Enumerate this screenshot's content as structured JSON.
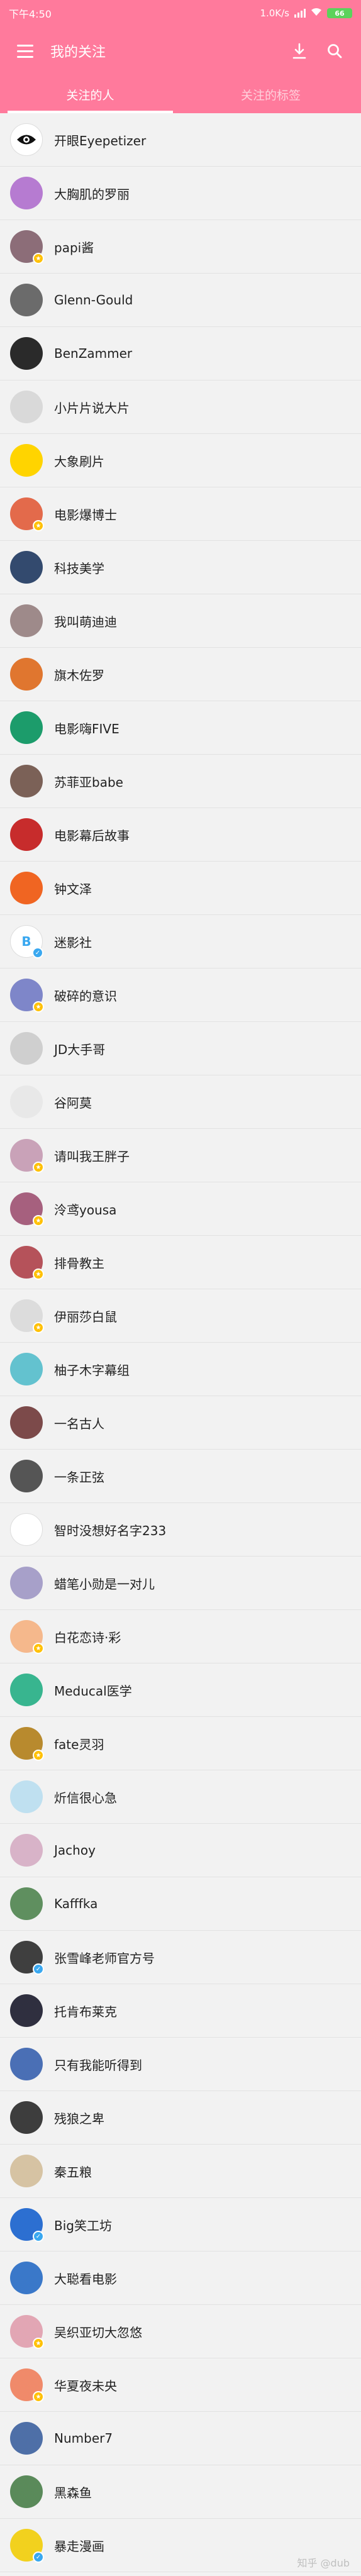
{
  "status": {
    "time": "下午4:50",
    "speed": "1.0K/s",
    "battery": "66"
  },
  "toolbar": {
    "title": "我的关注",
    "menu_icon": "menu-icon",
    "download_icon": "download-icon",
    "search_icon": "search-icon"
  },
  "tabs": [
    {
      "label": "关注的人",
      "active": true
    },
    {
      "label": "关注的标签",
      "active": false
    }
  ],
  "users": [
    {
      "name": "开眼Eyepetizer",
      "color": "#ffffff",
      "avatar": "eye",
      "badge": ""
    },
    {
      "name": "大胸肌的罗丽",
      "color": "#b67bd1",
      "avatar": "",
      "badge": ""
    },
    {
      "name": "papi酱",
      "color": "#8c6d78",
      "avatar": "",
      "badge": "gold"
    },
    {
      "name": "Glenn-Gould",
      "color": "#6b6b6b",
      "avatar": "",
      "badge": ""
    },
    {
      "name": "BenZammer",
      "color": "#2a2a2a",
      "avatar": "",
      "badge": ""
    },
    {
      "name": "小片片说大片",
      "color": "#d9d9d9",
      "avatar": "",
      "badge": ""
    },
    {
      "name": "大象刷片",
      "color": "#ffd400",
      "avatar": "",
      "badge": ""
    },
    {
      "name": "电影爆博士",
      "color": "#e36a4b",
      "avatar": "",
      "badge": "gold"
    },
    {
      "name": "科技美学",
      "color": "#334a6e",
      "avatar": "",
      "badge": ""
    },
    {
      "name": "我叫萌迪迪",
      "color": "#9e8a8a",
      "avatar": "",
      "badge": ""
    },
    {
      "name": "旗木佐罗",
      "color": "#e0762f",
      "avatar": "",
      "badge": ""
    },
    {
      "name": "电影嗨FIVE",
      "color": "#1c9c6b",
      "avatar": "",
      "badge": ""
    },
    {
      "name": "苏菲亚babe",
      "color": "#7b6157",
      "avatar": "",
      "badge": ""
    },
    {
      "name": "电影幕后故事",
      "color": "#c72c2c",
      "avatar": "",
      "badge": ""
    },
    {
      "name": "钟文泽",
      "color": "#f06522",
      "avatar": "",
      "badge": ""
    },
    {
      "name": "迷影社",
      "color": "#ffffff",
      "avatar": "B",
      "badge": "blue"
    },
    {
      "name": "破碎的意识",
      "color": "#7e86c9",
      "avatar": "",
      "badge": "gold"
    },
    {
      "name": "JD大手哥",
      "color": "#cfcfcf",
      "avatar": "",
      "badge": ""
    },
    {
      "name": "谷阿莫",
      "color": "#e8e8e8",
      "avatar": "",
      "badge": ""
    },
    {
      "name": "请叫我王胖子",
      "color": "#c9a2b8",
      "avatar": "",
      "badge": "gold"
    },
    {
      "name": "泠鸢yousa",
      "color": "#a6607e",
      "avatar": "",
      "badge": "gold"
    },
    {
      "name": "排骨教主",
      "color": "#b5525a",
      "avatar": "",
      "badge": "gold"
    },
    {
      "name": "伊丽莎白鼠",
      "color": "#dcdcdc",
      "avatar": "",
      "badge": "gold"
    },
    {
      "name": "柚子木字幕组",
      "color": "#63c2cf",
      "avatar": "",
      "badge": ""
    },
    {
      "name": "一名古人",
      "color": "#7c4a4a",
      "avatar": "",
      "badge": ""
    },
    {
      "name": "一条正弦",
      "color": "#555555",
      "avatar": "",
      "badge": ""
    },
    {
      "name": "智时没想好名字233",
      "color": "#ffffff",
      "avatar": "",
      "badge": ""
    },
    {
      "name": "蜡笔小勋是一对儿",
      "color": "#a7a0c9",
      "avatar": "",
      "badge": ""
    },
    {
      "name": "白花恋诗·彩",
      "color": "#f5b88c",
      "avatar": "",
      "badge": "gold"
    },
    {
      "name": "Meducal医学",
      "color": "#38b58f",
      "avatar": "",
      "badge": ""
    },
    {
      "name": "fate灵羽",
      "color": "#b88a2e",
      "avatar": "",
      "badge": "gold"
    },
    {
      "name": "炘信很心急",
      "color": "#bfe0f0",
      "avatar": "",
      "badge": ""
    },
    {
      "name": "Jachoy",
      "color": "#d8b3c8",
      "avatar": "",
      "badge": ""
    },
    {
      "name": "Kafffka",
      "color": "#5f8f5f",
      "avatar": "",
      "badge": ""
    },
    {
      "name": "张雪峰老师官方号",
      "color": "#3f3f3f",
      "avatar": "",
      "badge": "blue"
    },
    {
      "name": "托肯布莱克",
      "color": "#2f2f3f",
      "avatar": "",
      "badge": ""
    },
    {
      "name": "只有我能听得到",
      "color": "#4a6fb5",
      "avatar": "",
      "badge": ""
    },
    {
      "name": "残狼之卑",
      "color": "#3d3d3d",
      "avatar": "",
      "badge": ""
    },
    {
      "name": "秦五粮",
      "color": "#d6c3a3",
      "avatar": "",
      "badge": ""
    },
    {
      "name": "Big笑工坊",
      "color": "#2c6fd1",
      "avatar": "",
      "badge": "blue"
    },
    {
      "name": "大聪看电影",
      "color": "#3a78c9",
      "avatar": "",
      "badge": ""
    },
    {
      "name": "吴织亚切大忽悠",
      "color": "#e2a6b4",
      "avatar": "",
      "badge": "gold"
    },
    {
      "name": "华夏夜未央",
      "color": "#f08a6a",
      "avatar": "",
      "badge": "gold"
    },
    {
      "name": "Number7",
      "color": "#4e6fa7",
      "avatar": "",
      "badge": ""
    },
    {
      "name": "黑森鱼",
      "color": "#5a8a5a",
      "avatar": "",
      "badge": ""
    },
    {
      "name": "暴走漫画",
      "color": "#f2d11e",
      "avatar": "",
      "badge": "blue"
    }
  ],
  "watermark": "知乎 @dub"
}
